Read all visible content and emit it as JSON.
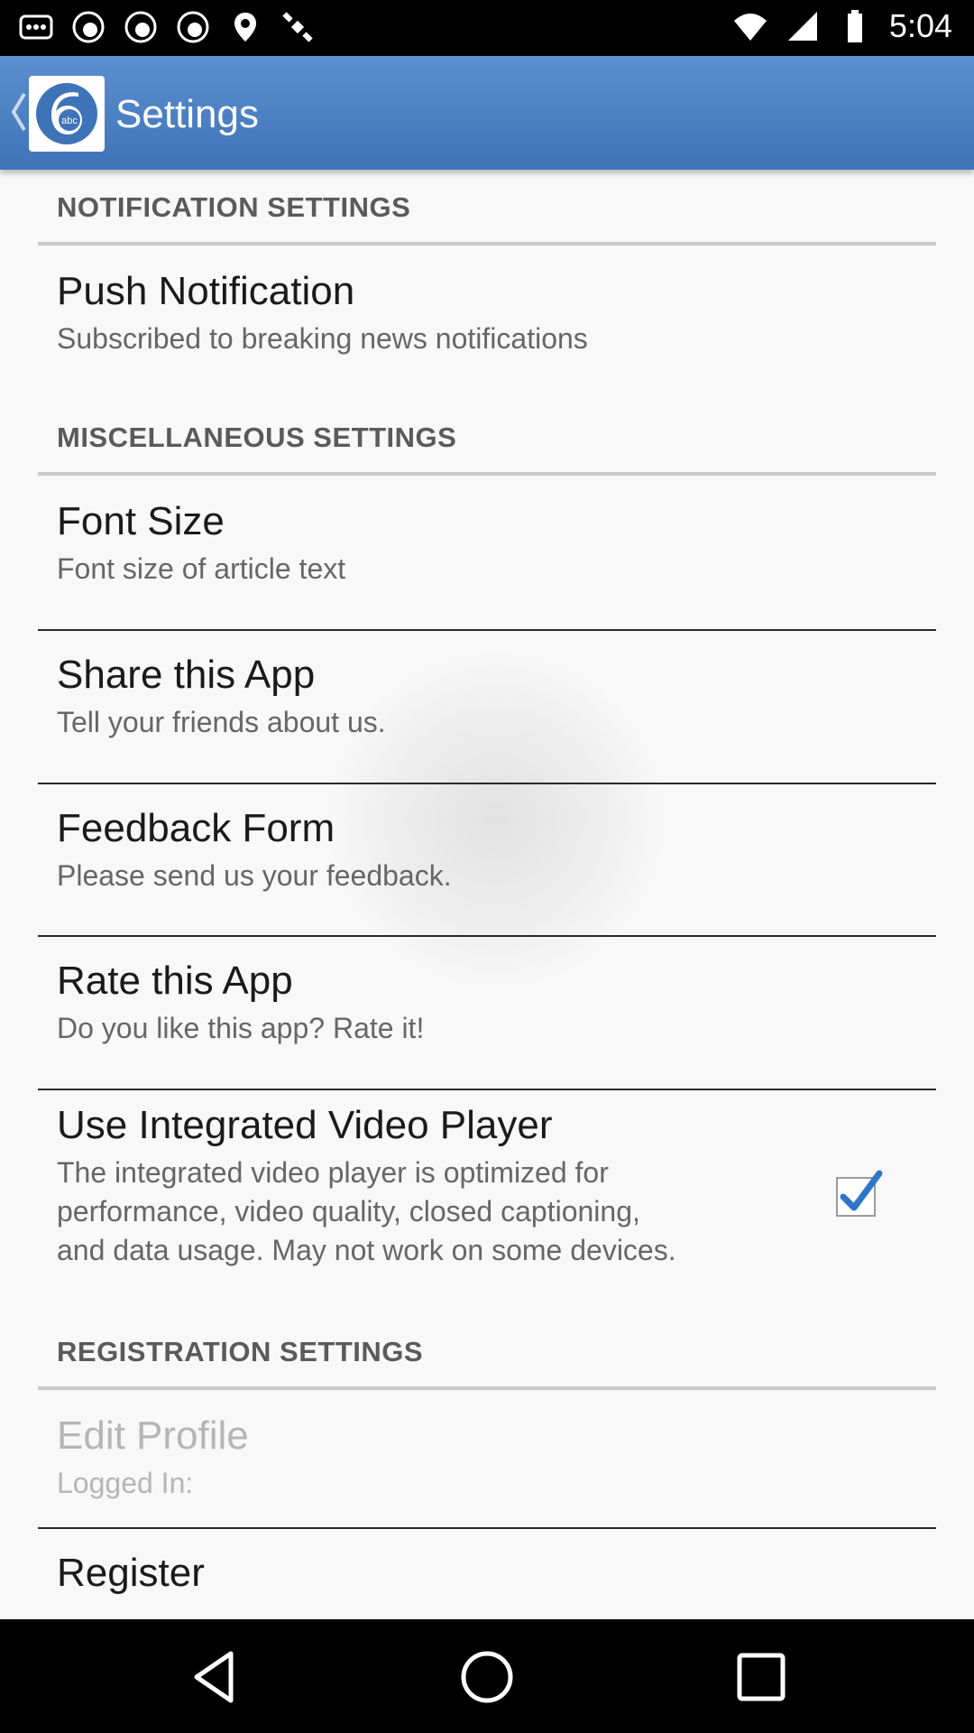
{
  "status_bar": {
    "time": "5:04",
    "icons": [
      "notification-dots-icon",
      "abc-news-icon",
      "abc-news-icon",
      "abc-news-icon",
      "fake-gps-icon",
      "satellite-icon",
      "wifi-icon",
      "signal-icon",
      "battery-icon"
    ]
  },
  "app_bar": {
    "title": "Settings",
    "logo_text": "abc"
  },
  "sections": {
    "notification": {
      "header": "NOTIFICATION SETTINGS"
    },
    "misc": {
      "header": "MISCELLANEOUS SETTINGS"
    },
    "registration": {
      "header": "REGISTRATION SETTINGS"
    }
  },
  "items": {
    "push": {
      "title": "Push Notification",
      "subtitle": "Subscribed to breaking news notifications"
    },
    "font": {
      "title": "Font Size",
      "subtitle": "Font size of article text"
    },
    "share": {
      "title": "Share this App",
      "subtitle": "Tell your friends about us."
    },
    "feedback": {
      "title": "Feedback Form",
      "subtitle": "Please send us your feedback."
    },
    "rate": {
      "title": "Rate this App",
      "subtitle": "Do you like this app? Rate it!"
    },
    "video": {
      "title": "Use Integrated Video Player",
      "subtitle_lines": [
        "The integrated video player is optimized for",
        "performance, video quality, closed captioning,",
        "and data usage. May not work on some devices."
      ],
      "checked": true
    },
    "profile": {
      "title": "Edit Profile",
      "subtitle": "Logged In:"
    },
    "register": {
      "title": "Register"
    }
  },
  "colors": {
    "app_bar": "#4a7fc4",
    "checkmark": "#2f76c9",
    "section_header": "#5a5a5a"
  }
}
